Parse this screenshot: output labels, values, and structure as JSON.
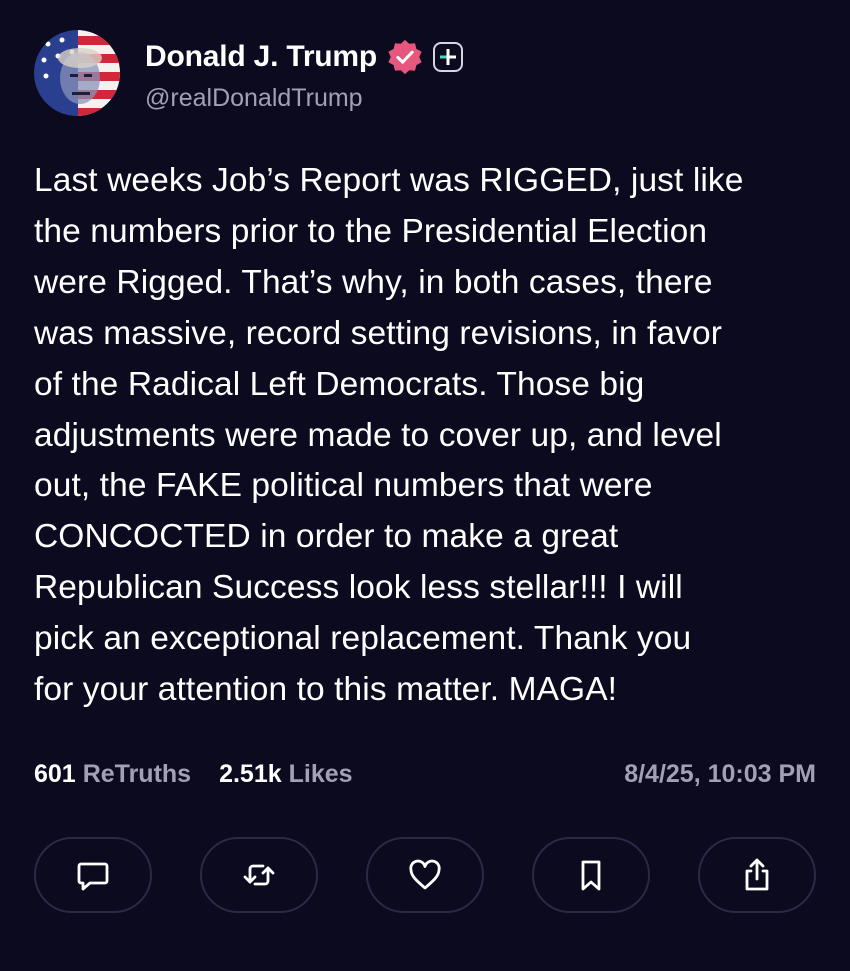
{
  "author": {
    "display_name": "Donald J. Trump",
    "handle": "@realDonaldTrump",
    "avatar_icon": "avatar-flag-portrait",
    "verified_icon": "verified-badge-icon",
    "follow_icon": "plus-icon"
  },
  "post": {
    "lines": [
      "Last weeks Job’s Report was RIGGED, just like",
      "the numbers prior to the Presidential Election",
      "were Rigged. That’s why, in both cases, there",
      "was massive, record setting revisions, in favor",
      "of the Radical Left Democrats. Those big",
      "adjustments were made to cover up, and level",
      "out, the FAKE political numbers that were",
      "CONCOCTED in order to make a great",
      "Republican Success look less stellar!!! I will",
      "pick an exceptional replacement. Thank you",
      "for your attention to this matter. MAGA!"
    ]
  },
  "stats": {
    "retruths_count": "601",
    "retruths_label": "ReTruths",
    "likes_count": "2.51k",
    "likes_label": "Likes",
    "timestamp": "8/4/25, 10:03 PM"
  },
  "actions": [
    {
      "icon": "reply-icon"
    },
    {
      "icon": "retruth-icon"
    },
    {
      "icon": "heart-icon"
    },
    {
      "icon": "bookmark-icon"
    },
    {
      "icon": "share-icon"
    }
  ],
  "colors": {
    "background": "#0b0a1f",
    "text": "#ffffff",
    "muted": "#a3a0b5",
    "verified": "#e5577d",
    "button_border": "#2b2945"
  }
}
